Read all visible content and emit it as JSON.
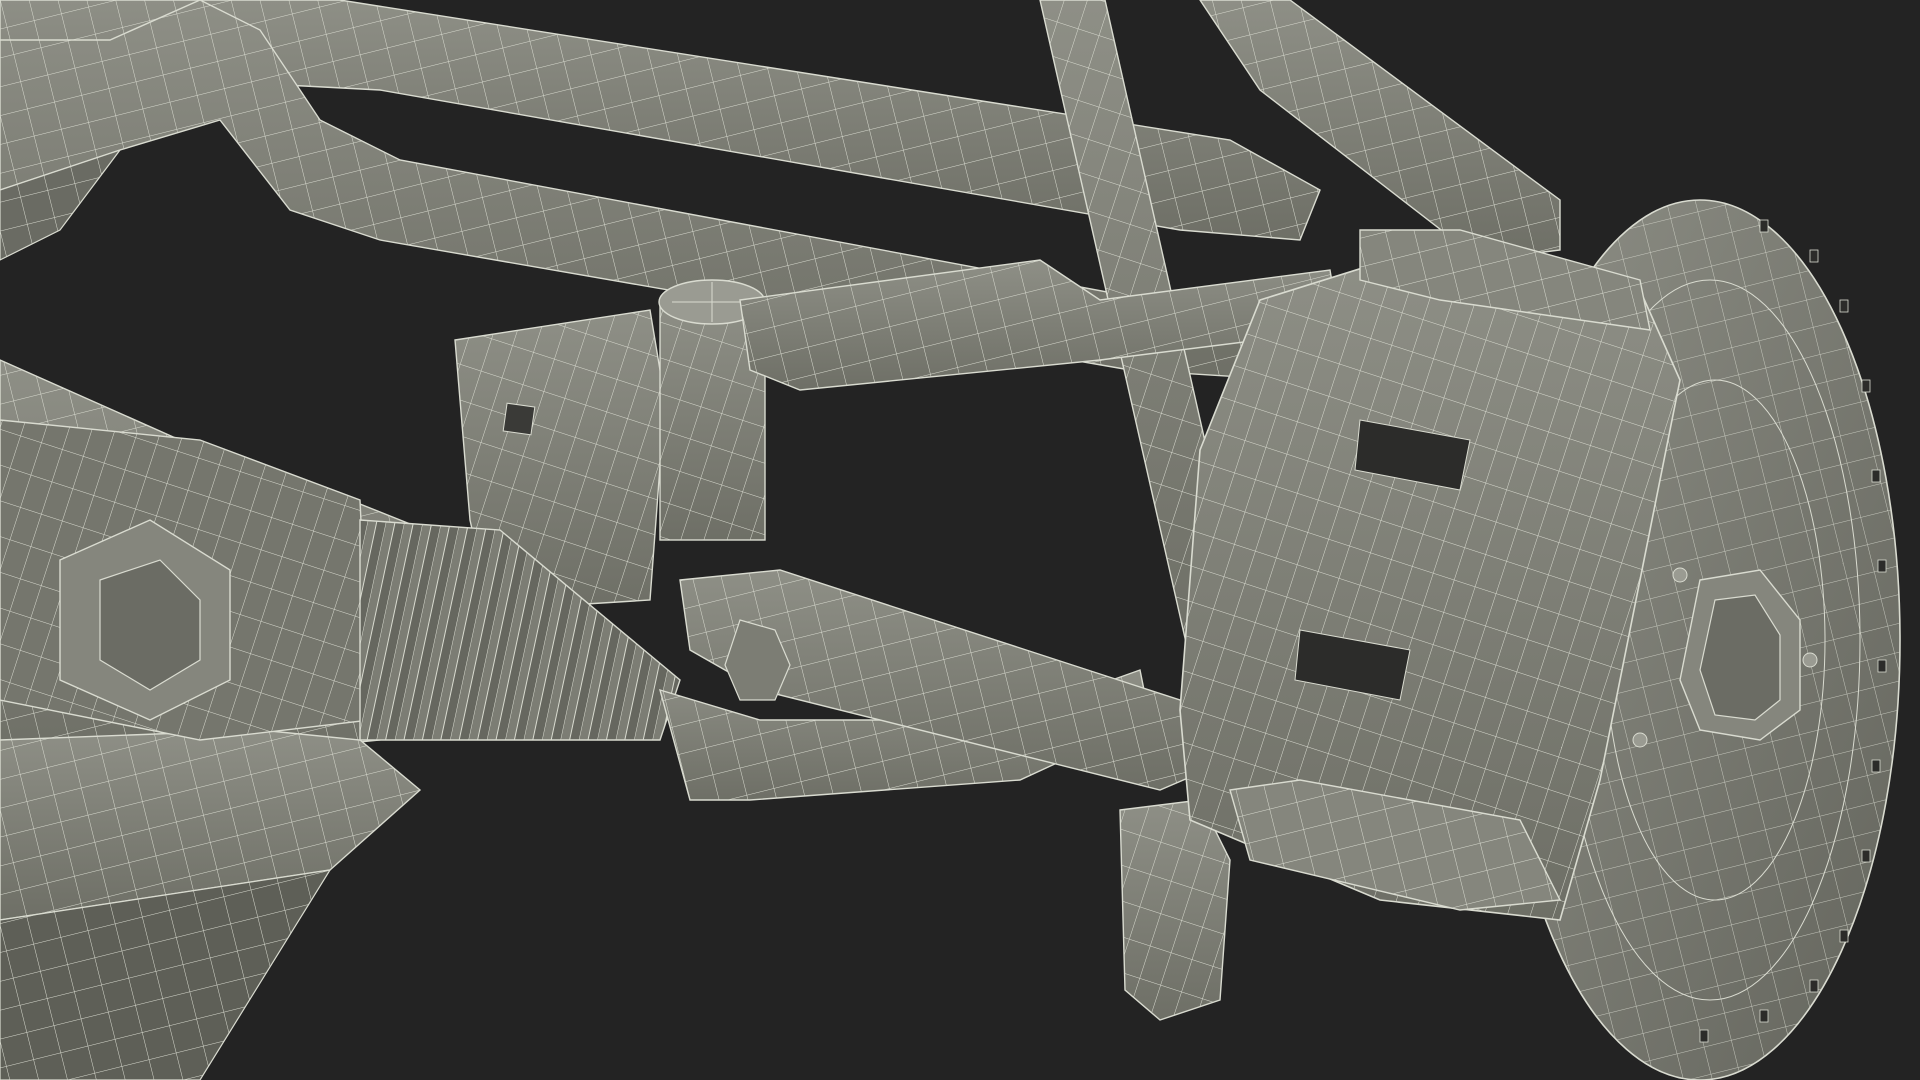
{
  "scene": {
    "subject": "wireframe-suspension-assembly",
    "colors": {
      "background": "#232323",
      "surface_light": "#8a8b81",
      "surface_mid": "#74756c",
      "surface_dark": "#5f6058",
      "wire": "#d9dbd0",
      "hole": "#2c2c2a"
    }
  }
}
